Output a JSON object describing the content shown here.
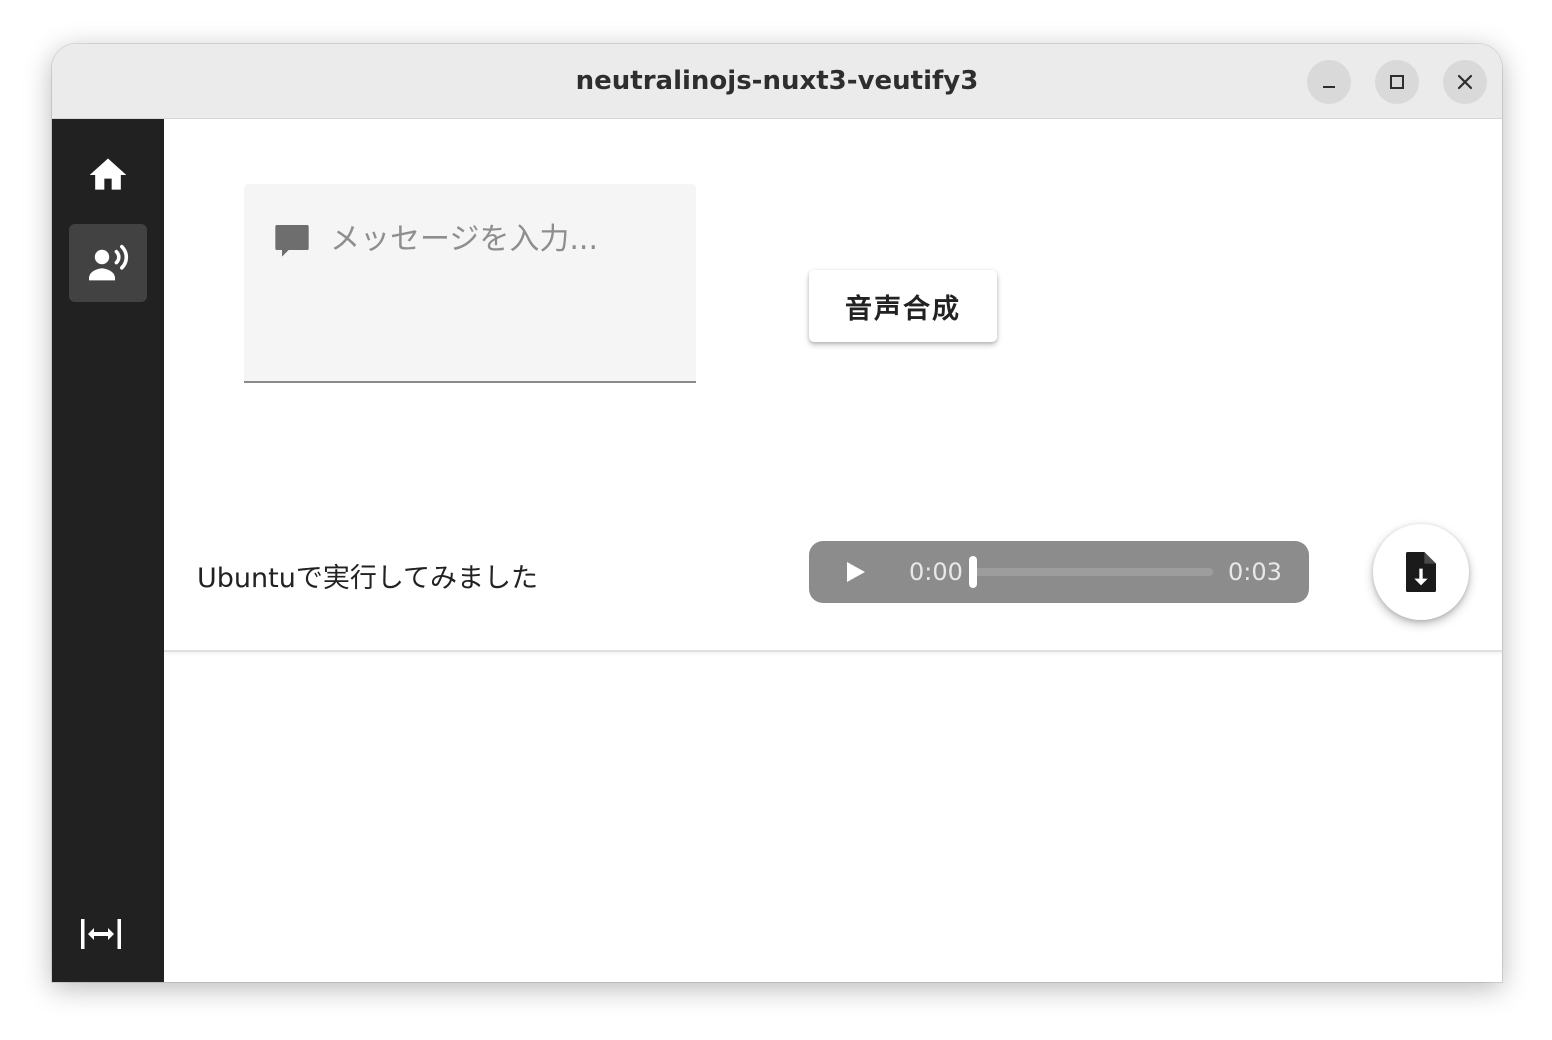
{
  "window": {
    "title": "neutralinojs-nuxt3-veutify3",
    "controls": [
      "minimize-icon",
      "maximize-icon",
      "close-icon"
    ]
  },
  "sidebar": {
    "items": [
      {
        "icon": "home-icon",
        "active": false
      },
      {
        "icon": "speaker-person-icon",
        "active": true
      }
    ],
    "footer_icon": "expand-horizontal-icon"
  },
  "form": {
    "message_placeholder": "メッセージを入力...",
    "message_icon": "comment-icon",
    "synthesize_label": "音声合成"
  },
  "result": {
    "text": "Ubuntuで実行してみました",
    "audio": {
      "current_time": "0:00",
      "duration": "0:03",
      "progress": 0
    },
    "download_icon": "file-download-icon"
  },
  "colors": {
    "sidebar_bg": "#212121",
    "sidebar_active": "#424242",
    "titlebar_bg": "#ebebeb",
    "audio_bg": "#8c8c8c"
  }
}
